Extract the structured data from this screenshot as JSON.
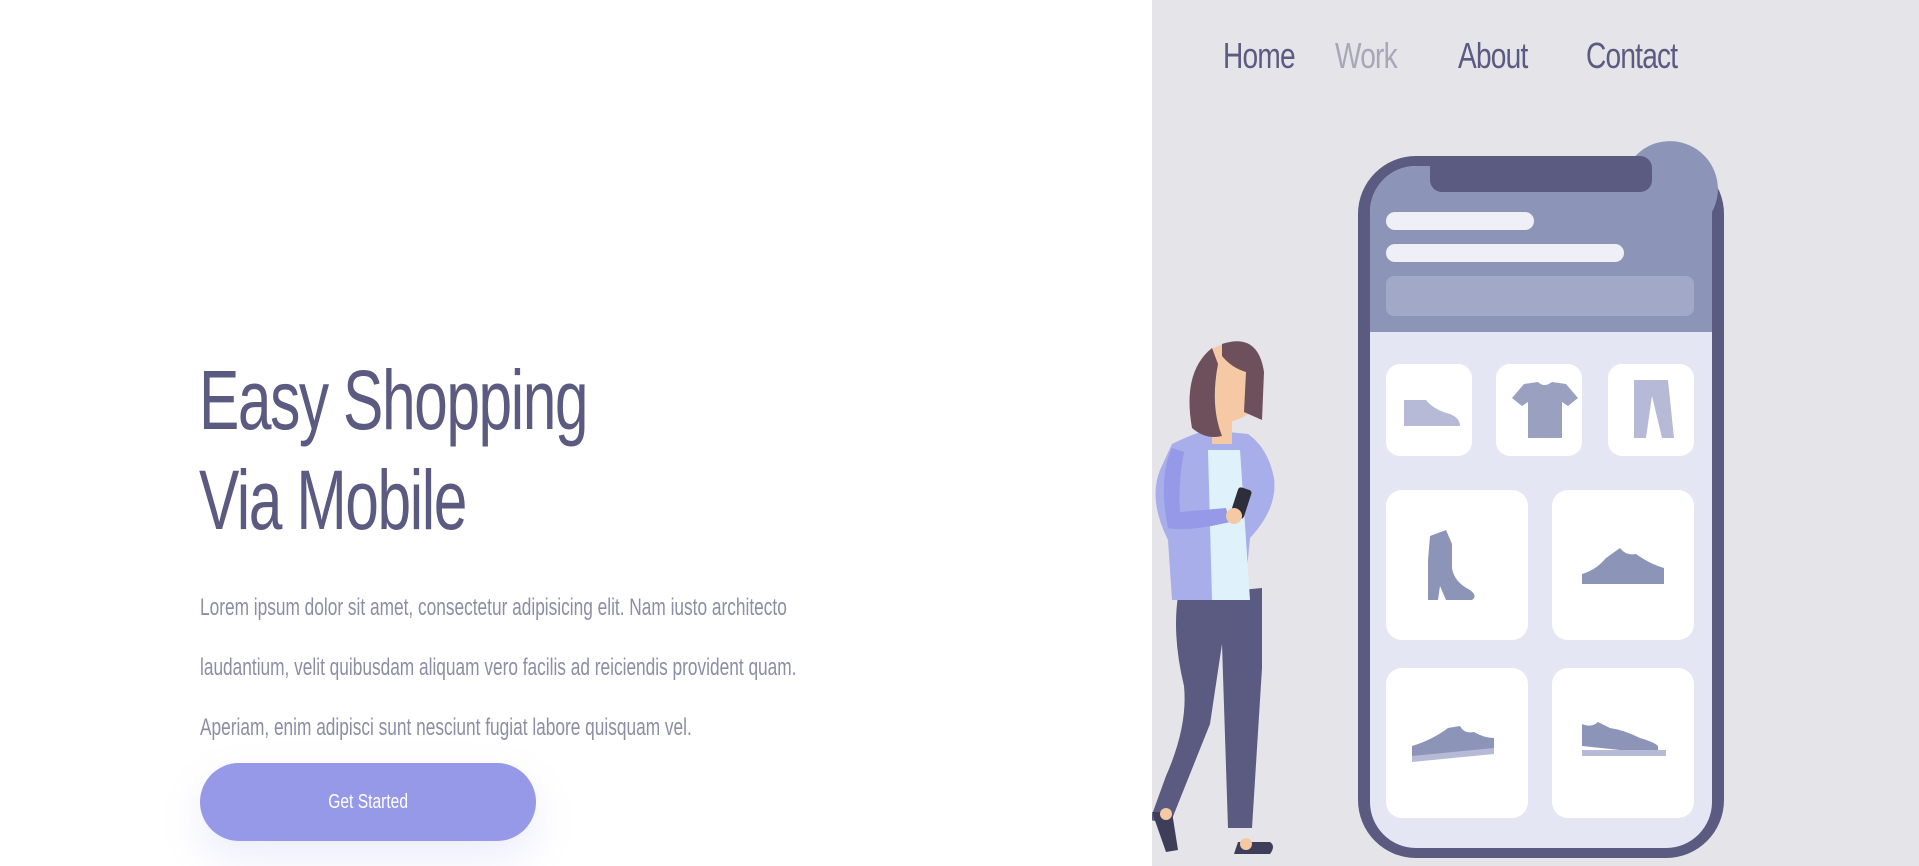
{
  "nav": {
    "items": [
      {
        "label": "Home",
        "active": false
      },
      {
        "label": "Work",
        "active": true
      },
      {
        "label": "About",
        "active": false
      },
      {
        "label": "Contact",
        "active": false
      }
    ]
  },
  "hero": {
    "title_line1": "Easy Shopping",
    "title_line2": "Via Mobile",
    "description_lines": [
      "Lorem ipsum dolor sit amet, consectetur adipisicing elit. Nam iusto architecto",
      "laudantium, velit quibusdam aliquam vero facilis ad reiciendis provident quam.",
      "Aperiam, enim adipisci sunt nesciunt fugiat labore quisquam vel."
    ],
    "cta_label": "Get Started"
  },
  "colors": {
    "primary_text": "#5b5a80",
    "muted_text": "#8e8da6",
    "nav_active": "#a8a7b8",
    "accent_button": "#9599e8",
    "panel_bg": "#e5e4e9",
    "phone_frame": "#5b5a80"
  },
  "illustration": {
    "icons": [
      "shoe-flat-icon",
      "tshirt-icon",
      "pants-icon",
      "boot-icon",
      "sneaker-icon",
      "sneaker-icon",
      "sneaker-icon"
    ]
  }
}
